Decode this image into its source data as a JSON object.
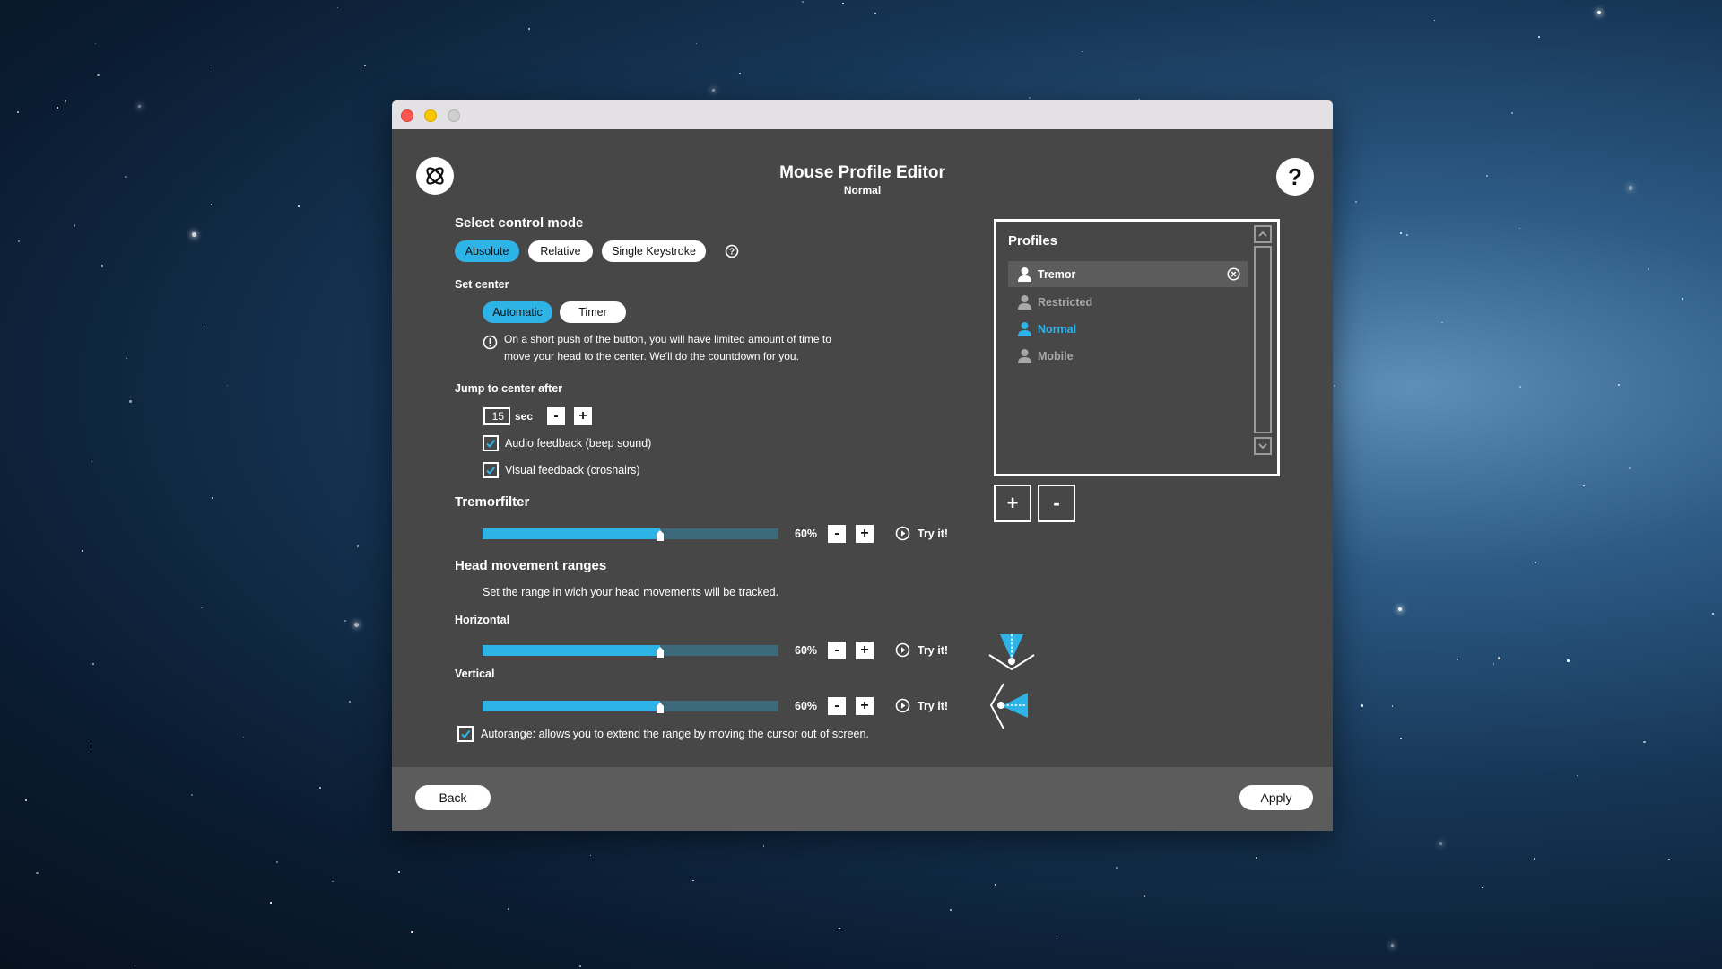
{
  "window": {
    "title": "Mouse Profile Editor",
    "subtitle": "Normal",
    "traffic_lights": [
      "close",
      "minimize",
      "zoom"
    ]
  },
  "header": {
    "logo_icon": "app-logo-icon",
    "help_label": "?"
  },
  "control_mode": {
    "heading": "Select control mode",
    "options": [
      {
        "label": "Absolute",
        "active": true
      },
      {
        "label": "Relative",
        "active": false
      },
      {
        "label": "Single Keystroke",
        "active": false
      }
    ],
    "help_icon": "question-circle-icon"
  },
  "set_center": {
    "heading": "Set center",
    "options": [
      {
        "label": "Automatic",
        "active": true
      },
      {
        "label": "Timer",
        "active": false
      }
    ],
    "info_line1": "On a short push of the button, you will have limited amount of time to",
    "info_line2": "move your head to the center. We'll do the countdown for you."
  },
  "jump": {
    "heading": "Jump to center after",
    "value": "15",
    "unit": "sec",
    "minus": "-",
    "plus": "+",
    "audio_feedback": {
      "label": "Audio feedback (beep sound)",
      "checked": true
    },
    "visual_feedback": {
      "label": "Visual feedback (croshairs)",
      "checked": true
    }
  },
  "tremorfilter": {
    "heading": "Tremorfilter",
    "value_percent": 60,
    "value_label": "60%",
    "minus": "-",
    "plus": "+",
    "try_label": "Try it!"
  },
  "head_ranges": {
    "heading": "Head movement ranges",
    "description": "Set the range in wich your head movements will be tracked.",
    "horizontal": {
      "label": "Horizontal",
      "value_percent": 60,
      "value_label": "60%",
      "minus": "-",
      "plus": "+",
      "try_label": "Try it!"
    },
    "vertical": {
      "label": "Vertical",
      "value_percent": 60,
      "value_label": "60%",
      "minus": "-",
      "plus": "+",
      "try_label": "Try it!"
    },
    "autorange": {
      "label": "Autorange: allows you to extend the range by moving the cursor out of screen.",
      "checked": true
    }
  },
  "profiles": {
    "heading": "Profiles",
    "items": [
      {
        "name": "Tremor",
        "state": "selected"
      },
      {
        "name": "Restricted",
        "state": "inactive"
      },
      {
        "name": "Normal",
        "state": "current"
      },
      {
        "name": "Mobile",
        "state": "inactive"
      }
    ],
    "add_label": "+",
    "remove_label": "-"
  },
  "footer": {
    "back_label": "Back",
    "apply_label": "Apply"
  },
  "colors": {
    "accent": "#2db3e6",
    "panel_bg": "#474747",
    "footer_bg": "#5c5c5c",
    "slider_track": "#3d6a7b",
    "inactive_text": "#a8a8a8"
  }
}
